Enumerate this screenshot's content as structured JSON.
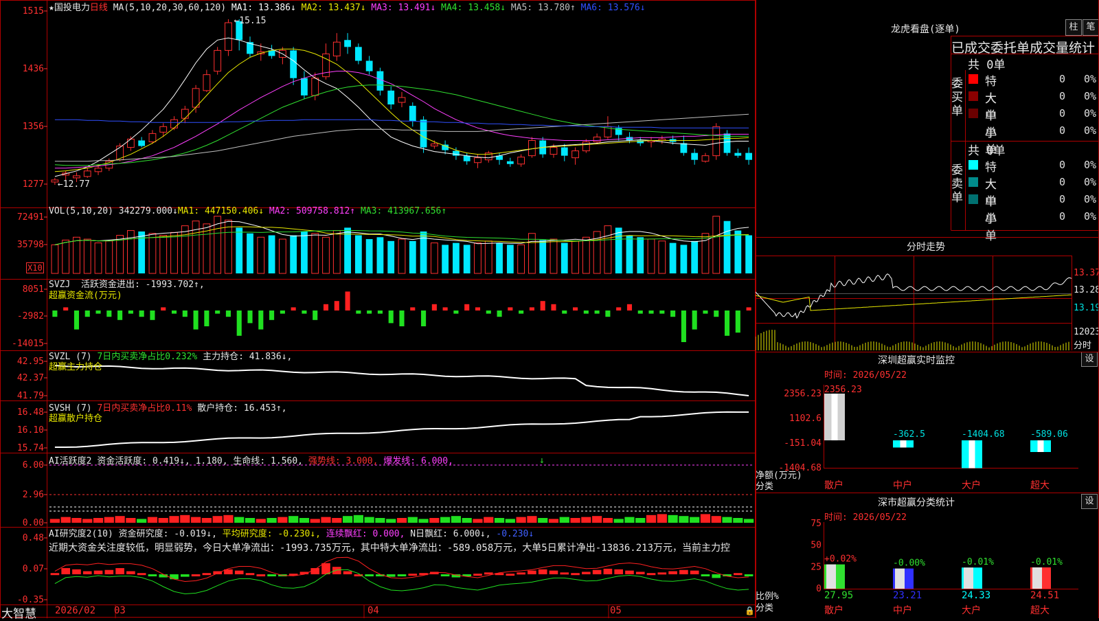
{
  "stock": {
    "name_prefix": "★",
    "name": "国投电力",
    "period": "日线"
  },
  "colors": {
    "up": "#ff3030",
    "down": "#00e8ff",
    "bg": "#000000",
    "grid": "#b00000"
  },
  "main": {
    "ma_header": "MA(5,10,20,30,60,120)",
    "ma": [
      {
        "label": "MA1: 13.386↓",
        "color": "#ffffff"
      },
      {
        "label": "MA2: 13.437↓",
        "color": "#e8e800"
      },
      {
        "label": "MA3: 13.491↓",
        "color": "#ff40ff"
      },
      {
        "label": "MA4: 13.458↓",
        "color": "#30e030"
      },
      {
        "label": "MA5: 13.780↑",
        "color": "#c0c0c0"
      },
      {
        "label": "MA6: 13.576↓",
        "color": "#3050ff"
      }
    ],
    "y_ticks": [
      "1515",
      "1436",
      "1356",
      "1277"
    ],
    "y_range": [
      12.77,
      15.15
    ],
    "high_label": "15.15",
    "low_label": "12.77",
    "candles": [
      [
        12.8,
        12.83,
        12.76,
        12.86
      ],
      [
        12.9,
        12.93,
        12.82,
        12.96
      ],
      [
        12.86,
        12.89,
        12.8,
        12.94
      ],
      [
        12.88,
        12.96,
        12.86,
        13.0
      ],
      [
        12.95,
        13.0,
        12.9,
        13.05
      ],
      [
        13.0,
        13.1,
        12.96,
        13.14
      ],
      [
        13.12,
        13.32,
        13.1,
        13.36
      ],
      [
        13.3,
        13.42,
        13.25,
        13.46
      ],
      [
        13.4,
        13.32,
        13.3,
        13.45
      ],
      [
        13.38,
        13.5,
        13.35,
        13.55
      ],
      [
        13.52,
        13.6,
        13.45,
        13.65
      ],
      [
        13.58,
        13.7,
        13.55,
        13.75
      ],
      [
        13.72,
        13.85,
        13.65,
        13.9
      ],
      [
        13.88,
        14.15,
        13.8,
        14.2
      ],
      [
        14.12,
        14.35,
        14.1,
        14.42
      ],
      [
        14.4,
        14.7,
        14.35,
        14.75
      ],
      [
        14.7,
        15.1,
        14.62,
        15.15
      ],
      [
        15.12,
        14.85,
        14.7,
        15.15
      ],
      [
        14.82,
        14.65,
        14.6,
        14.9
      ],
      [
        14.65,
        14.68,
        14.55,
        14.8
      ],
      [
        14.7,
        14.62,
        14.58,
        14.78
      ],
      [
        14.6,
        14.7,
        14.5,
        14.75
      ],
      [
        14.7,
        14.3,
        14.2,
        14.75
      ],
      [
        14.3,
        14.05,
        14.0,
        14.4
      ],
      [
        14.05,
        14.3,
        13.98,
        14.38
      ],
      [
        14.32,
        14.65,
        14.28,
        14.8
      ],
      [
        14.62,
        14.82,
        14.55,
        14.95
      ],
      [
        14.85,
        14.75,
        14.65,
        14.95
      ],
      [
        14.75,
        14.55,
        14.5,
        14.8
      ],
      [
        14.55,
        14.4,
        14.35,
        14.62
      ],
      [
        14.4,
        14.12,
        14.05,
        14.45
      ],
      [
        14.12,
        13.92,
        13.85,
        14.18
      ],
      [
        13.95,
        14.02,
        13.88,
        14.1
      ],
      [
        13.9,
        13.68,
        13.6,
        13.95
      ],
      [
        13.7,
        13.3,
        13.22,
        13.75
      ],
      [
        13.32,
        13.35,
        13.28,
        13.4
      ],
      [
        13.34,
        13.26,
        13.2,
        13.4
      ],
      [
        13.25,
        13.18,
        13.12,
        13.3
      ],
      [
        13.18,
        13.1,
        13.05,
        13.22
      ],
      [
        13.08,
        13.15,
        13.0,
        13.2
      ],
      [
        13.12,
        13.22,
        13.08,
        13.25
      ],
      [
        13.18,
        13.12,
        13.05,
        13.22
      ],
      [
        13.1,
        13.06,
        13.02,
        13.15
      ],
      [
        13.06,
        13.16,
        13.02,
        13.2
      ],
      [
        13.18,
        13.4,
        13.15,
        13.45
      ],
      [
        13.4,
        13.2,
        13.15,
        13.45
      ],
      [
        13.2,
        13.3,
        13.15,
        13.35
      ],
      [
        13.3,
        13.18,
        13.1,
        13.35
      ],
      [
        13.15,
        13.25,
        13.05,
        13.3
      ],
      [
        13.25,
        13.38,
        13.22,
        13.42
      ],
      [
        13.38,
        13.45,
        13.35,
        13.5
      ],
      [
        13.45,
        13.6,
        13.42,
        13.75
      ],
      [
        13.58,
        13.48,
        13.4,
        13.62
      ],
      [
        13.45,
        13.4,
        13.36,
        13.52
      ],
      [
        13.4,
        13.36,
        13.32,
        13.45
      ],
      [
        13.38,
        13.4,
        13.3,
        13.45
      ],
      [
        13.4,
        13.42,
        13.35,
        13.47
      ],
      [
        13.42,
        13.38,
        13.34,
        13.47
      ],
      [
        13.36,
        13.22,
        13.18,
        13.47
      ],
      [
        13.22,
        13.12,
        13.05,
        13.28
      ],
      [
        13.1,
        13.18,
        13.08,
        13.22
      ],
      [
        13.18,
        13.6,
        13.12,
        13.65
      ],
      [
        13.5,
        13.22,
        13.18,
        13.55
      ],
      [
        13.22,
        13.18,
        13.15,
        13.28
      ],
      [
        13.22,
        13.12,
        13.05,
        13.3
      ]
    ],
    "ma_series": {
      "ma1": [
        12.88,
        12.92,
        12.96,
        13.02,
        13.1,
        13.2,
        13.3,
        13.42,
        13.55,
        13.7,
        13.85,
        14.05,
        14.28,
        14.52,
        14.72,
        14.85,
        14.88,
        14.85,
        14.8,
        14.76,
        14.72,
        14.65,
        14.55,
        14.42,
        14.3,
        14.22,
        14.15,
        14.02,
        13.88,
        13.72,
        13.58,
        13.45,
        13.38,
        13.32,
        13.28,
        13.24,
        13.22,
        13.2,
        13.18,
        13.16,
        13.15,
        13.18,
        13.22,
        13.25,
        13.28,
        13.3,
        13.32,
        13.33,
        13.34,
        13.35,
        13.36,
        13.38,
        13.39,
        13.4,
        13.41,
        13.4,
        13.38,
        13.36,
        13.35,
        13.34,
        13.33,
        13.36,
        13.38,
        13.39,
        13.39
      ],
      "ma2": [
        12.95,
        12.96,
        12.98,
        13.0,
        13.04,
        13.08,
        13.14,
        13.2,
        13.28,
        13.36,
        13.46,
        13.58,
        13.72,
        13.88,
        14.05,
        14.22,
        14.38,
        14.5,
        14.6,
        14.66,
        14.7,
        14.72,
        14.72,
        14.7,
        14.65,
        14.58,
        14.5,
        14.38,
        14.25,
        14.1,
        13.95,
        13.8,
        13.66,
        13.55,
        13.45,
        13.38,
        13.32,
        13.26,
        13.22,
        13.2,
        13.2,
        13.22,
        13.24,
        13.26,
        13.28,
        13.3,
        13.31,
        13.32,
        13.33,
        13.34,
        13.35,
        13.36,
        13.37,
        13.38,
        13.39,
        13.4,
        13.4,
        13.4,
        13.4,
        13.4,
        13.41,
        13.42,
        13.43,
        13.43,
        13.44
      ],
      "ma3": [
        13.0,
        13.0,
        13.01,
        13.02,
        13.03,
        13.05,
        13.07,
        13.1,
        13.14,
        13.18,
        13.24,
        13.3,
        13.38,
        13.46,
        13.55,
        13.64,
        13.74,
        13.84,
        13.93,
        14.02,
        14.1,
        14.18,
        14.25,
        14.3,
        14.35,
        14.38,
        14.4,
        14.4,
        14.38,
        14.34,
        14.28,
        14.22,
        14.14,
        14.05,
        13.96,
        13.86,
        13.78,
        13.7,
        13.64,
        13.58,
        13.54,
        13.5,
        13.47,
        13.45,
        13.43,
        13.42,
        13.41,
        13.4,
        13.4,
        13.4,
        13.4,
        13.41,
        13.42,
        13.43,
        13.44,
        13.44,
        13.44,
        13.45,
        13.46,
        13.46,
        13.47,
        13.48,
        13.49,
        13.49,
        13.49
      ],
      "ma4": [
        13.05,
        13.04,
        13.04,
        13.04,
        13.05,
        13.06,
        13.07,
        13.08,
        13.1,
        13.12,
        13.15,
        13.18,
        13.22,
        13.27,
        13.33,
        13.4,
        13.48,
        13.56,
        13.64,
        13.72,
        13.8,
        13.88,
        13.94,
        14.0,
        14.05,
        14.1,
        14.14,
        14.17,
        14.19,
        14.2,
        14.2,
        14.19,
        14.18,
        14.16,
        14.14,
        14.12,
        14.09,
        14.06,
        14.02,
        13.98,
        13.94,
        13.9,
        13.86,
        13.82,
        13.78,
        13.74,
        13.7,
        13.67,
        13.64,
        13.62,
        13.6,
        13.58,
        13.56,
        13.55,
        13.54,
        13.53,
        13.52,
        13.51,
        13.5,
        13.49,
        13.48,
        13.47,
        13.46,
        13.46,
        13.46
      ],
      "ma5": [
        13.1,
        13.1,
        13.1,
        13.1,
        13.11,
        13.11,
        13.12,
        13.13,
        13.14,
        13.15,
        13.16,
        13.17,
        13.19,
        13.21,
        13.23,
        13.25,
        13.28,
        13.31,
        13.34,
        13.37,
        13.4,
        13.43,
        13.46,
        13.48,
        13.5,
        13.52,
        13.54,
        13.55,
        13.56,
        13.56,
        13.56,
        13.56,
        13.55,
        13.55,
        13.54,
        13.54,
        13.53,
        13.53,
        13.53,
        13.53,
        13.54,
        13.55,
        13.56,
        13.57,
        13.58,
        13.59,
        13.6,
        13.61,
        13.62,
        13.63,
        13.64,
        13.65,
        13.66,
        13.67,
        13.68,
        13.69,
        13.7,
        13.71,
        13.72,
        13.73,
        13.74,
        13.75,
        13.76,
        13.77,
        13.78
      ],
      "ma6": [
        13.7,
        13.7,
        13.7,
        13.69,
        13.69,
        13.68,
        13.68,
        13.67,
        13.67,
        13.66,
        13.66,
        13.66,
        13.66,
        13.66,
        13.66,
        13.66,
        13.67,
        13.67,
        13.68,
        13.68,
        13.69,
        13.69,
        13.69,
        13.7,
        13.7,
        13.7,
        13.7,
        13.7,
        13.7,
        13.7,
        13.69,
        13.69,
        13.68,
        13.68,
        13.67,
        13.67,
        13.66,
        13.66,
        13.65,
        13.65,
        13.64,
        13.64,
        13.63,
        13.63,
        13.62,
        13.62,
        13.61,
        13.61,
        13.61,
        13.6,
        13.6,
        13.6,
        13.59,
        13.59,
        13.59,
        13.59,
        13.58,
        13.58,
        13.58,
        13.58,
        13.58,
        13.58,
        13.58,
        13.58,
        13.58
      ]
    }
  },
  "vol": {
    "header": "VOL(5,10,20)",
    "value": "342279.000↓",
    "ma": [
      {
        "label": "MA1: 447150.406↓",
        "color": "#ffffff"
      },
      {
        "label": "MA2: 509758.812↑",
        "color": "#ff40ff"
      },
      {
        "label": "MA3: 413967.656↑",
        "color": "#30e030"
      }
    ],
    "y_ticks": [
      "72491",
      "35798"
    ],
    "unit": "X10",
    "values": [
      30,
      35,
      38,
      36,
      32,
      34,
      40,
      45,
      44,
      42,
      40,
      43,
      50,
      55,
      52,
      60,
      56,
      48,
      42,
      38,
      40,
      36,
      40,
      44,
      42,
      38,
      45,
      48,
      40,
      36,
      38,
      34,
      36,
      34,
      44,
      32,
      30,
      32,
      30,
      32,
      34,
      32,
      30,
      30,
      42,
      35,
      36,
      32,
      34,
      38,
      44,
      50,
      48,
      40,
      38,
      36,
      34,
      32,
      30,
      34,
      42,
      60,
      55,
      45,
      40
    ]
  },
  "svzj": {
    "header": "SVZJ",
    "active": "活跃资金进出: -1993.702↑,",
    "sub": "超赢资金流(万元)",
    "y_ticks": [
      "8051",
      "-2982",
      "-14015"
    ],
    "values": [
      -2,
      1,
      -6,
      -2,
      -1,
      -2,
      -3,
      -1,
      -2,
      -3,
      1,
      -1,
      -2,
      -6,
      -5,
      -1,
      -2,
      -8,
      -4,
      -6,
      -3,
      -1,
      1,
      -1,
      -3,
      2,
      3,
      6,
      -1,
      -1,
      -1,
      -4,
      -5,
      1,
      -5,
      2,
      1,
      -1,
      2,
      1,
      -1,
      -2,
      1,
      -1,
      1,
      3,
      2,
      -1,
      1,
      -1,
      -1,
      -2,
      1,
      2,
      -1,
      -1,
      -1,
      -2,
      -10,
      -6,
      -1,
      -2,
      -8,
      -7,
      1
    ],
    "scale": 1000
  },
  "svzl": {
    "header": "SVZL (7)",
    "ratio": "7日内买卖净占比0.232%",
    "hold": "主力持仓: 41.836↓,",
    "sub": "超赢主力持仓",
    "y_ticks": [
      "42.95",
      "42.37",
      "41.79"
    ]
  },
  "svsh": {
    "header": "SVSH (7)",
    "ratio": "7日内买卖净占比0.11%",
    "hold": "散户持仓: 16.453↑,",
    "sub": "超赢散户持仓",
    "y_ticks": [
      "16.48",
      "16.10",
      "15.74"
    ]
  },
  "ai1": {
    "header": "AI活跃度2",
    "a": "资金活跃度: 0.419↓,",
    "b": "1.180,",
    "c": "生命线: 1.560,",
    "d": "强势线: 3.000,",
    "e": "爆发线: 6.000,",
    "y_ticks": [
      "6.00",
      "2.96",
      "0.00"
    ],
    "values": [
      0.4,
      0.6,
      0.5,
      0.4,
      0.5,
      0.6,
      0.7,
      0.5,
      0.4,
      0.6,
      0.5,
      0.7,
      0.8,
      0.6,
      0.5,
      0.7,
      0.8,
      0.6,
      0.5,
      0.4,
      0.5,
      0.6,
      0.7,
      0.5,
      0.4,
      0.6,
      0.5,
      0.7,
      0.8,
      0.6,
      0.5,
      0.4,
      0.5,
      0.6,
      0.4,
      0.5,
      0.6,
      0.7,
      0.5,
      0.4,
      0.6,
      0.5,
      0.4,
      0.6,
      0.7,
      0.5,
      0.4,
      0.6,
      0.5,
      0.6,
      0.7,
      0.5,
      0.4,
      0.6,
      0.5,
      0.8,
      0.9,
      0.8,
      0.7,
      0.6,
      0.9,
      0.7,
      0.6,
      0.5,
      0.4
    ]
  },
  "ai2": {
    "header": "AI研究度2(10)",
    "a": "资金研究度: -0.019↓,",
    "b": "平均研究度: -0.230↓,",
    "c": "连续飘红: 0.000,",
    "d": "N日飘红: 6.000↓,",
    "e": "-0.230↓",
    "summary": "近期大资金关注度较低，明显弱势，今日大单净流出：-1993.735万元，其中特大单净流出：-589.058万元，大单5日累计净出-13836.213万元，当前主力控",
    "y_ticks": [
      "0.48",
      "0.07",
      "-0.35"
    ],
    "values": [
      0.02,
      0.1,
      0.08,
      0.05,
      0.06,
      0.07,
      0.1,
      0.05,
      0.02,
      -0.02,
      -0.05,
      -0.08,
      -0.04,
      0.0,
      0.02,
      0.05,
      0.08,
      0.06,
      0.02,
      0.0,
      -0.03,
      -0.02,
      0.01,
      0.04,
      0.1,
      0.18,
      0.12,
      0.05,
      0.0,
      -0.02,
      -0.03,
      -0.04,
      -0.02,
      0.01,
      0.02,
      0.04,
      -0.03,
      -0.05,
      -0.02,
      0.01,
      0.03,
      0.02,
      0.01,
      0.03,
      0.06,
      0.08,
      0.06,
      0.03,
      0.02,
      0.04,
      0.07,
      0.09,
      0.08,
      0.06,
      0.04,
      0.02,
      0.03,
      0.05,
      0.07,
      0.06,
      -0.03,
      -0.06,
      -0.02,
      0.02,
      -0.01
    ]
  },
  "xaxis": {
    "labels": [
      "2026/02",
      "03",
      "04",
      "05"
    ]
  },
  "footer": {
    "brand": "大智慧"
  },
  "lhb": {
    "title": "龙虎看盘(逐单)",
    "btn_zhu": "柱",
    "btn_bi": "笔",
    "stat_title": "已成交委托单成交量统计",
    "buy_total": "共 0单",
    "buy_label": "委买单",
    "sell_total": "共 0单",
    "sell_label": "委卖单",
    "buy_rows": [
      {
        "name": "特大",
        "color": "#ff0000",
        "count": "0",
        "pct": "0%"
      },
      {
        "name": "大单",
        "color": "#8b0000",
        "count": "0",
        "pct": "0%"
      },
      {
        "name": "中单",
        "color": "#6b0000",
        "count": "0",
        "pct": "0%"
      },
      {
        "name": "小单",
        "color": "#000000",
        "count": "0",
        "pct": "0%"
      }
    ],
    "sell_rows": [
      {
        "name": "特大",
        "color": "#00ffff",
        "count": "0",
        "pct": "0%"
      },
      {
        "name": "大单",
        "color": "#008b8b",
        "count": "0",
        "pct": "0%"
      },
      {
        "name": "中单",
        "color": "#007070",
        "count": "0",
        "pct": "0%"
      },
      {
        "name": "小单",
        "color": "#000000",
        "count": "0",
        "pct": "0%"
      }
    ]
  },
  "fenshi": {
    "title": "分时走势",
    "y_ticks": [
      "13.37",
      "13.28",
      "13.19"
    ],
    "vol_tick": "12023",
    "vol_unit": "分时"
  },
  "monitor": {
    "title": "深圳超赢实时监控",
    "set": "设",
    "time": "时间: 2026/05/22",
    "y_ticks": [
      "2356.23",
      "1102.6",
      "-151.04",
      "-1404.68"
    ],
    "ylabel1": "净额(万元)",
    "ylabel2": "分类",
    "bars": [
      {
        "cat": "散户",
        "value": "2356.23",
        "v": 2356.23
      },
      {
        "cat": "中户",
        "value": "-362.5",
        "v": -362.5
      },
      {
        "cat": "大户",
        "value": "-1404.68",
        "v": -1404.68
      },
      {
        "cat": "超大",
        "value": "-589.06",
        "v": -589.06
      }
    ]
  },
  "classify": {
    "title": "深市超赢分类统计",
    "set": "设",
    "time": "时间: 2026/05/22",
    "y_ticks": [
      "75",
      "50",
      "25",
      "0"
    ],
    "ylabel1": "比例%",
    "ylabel2": "分类",
    "bars": [
      {
        "cat": "散户",
        "pct": "+0.02%",
        "value": "27.95",
        "v": 27.95,
        "color": "#30e030"
      },
      {
        "cat": "中户",
        "pct": "-0.00%",
        "value": "23.21",
        "v": 23.21,
        "color": "#3030ff"
      },
      {
        "cat": "大户",
        "pct": "-0.01%",
        "value": "24.33",
        "v": 24.33,
        "color": "#00ffff"
      },
      {
        "cat": "超大",
        "pct": "-0.01%",
        "value": "24.51",
        "v": 24.51,
        "color": "#ff3030"
      }
    ]
  }
}
